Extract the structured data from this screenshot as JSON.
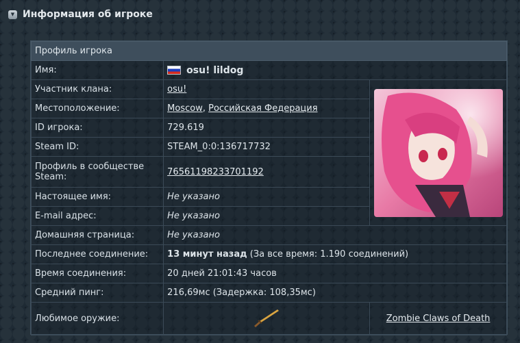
{
  "header": {
    "title": "Информация об игроке"
  },
  "profile": {
    "heading": "Профиль игрока",
    "name_label": "Имя:",
    "name_value": "osu! lildog",
    "clan_label": "Участник клана:",
    "clan_value": "osu!",
    "location_label": "Местоположение:",
    "location_city": "Moscow",
    "location_sep": ", ",
    "location_country": "Российская Федерация",
    "player_id_label": "ID игрока:",
    "player_id_value": "729.619",
    "steam_id_label": "Steam ID:",
    "steam_id_value": "STEAM_0:0:136717732",
    "steam_profile_label": "Профиль в сообществе Steam:",
    "steam_profile_value": "76561198233701192",
    "real_name_label": "Настоящее имя:",
    "real_name_value": "Не указано",
    "email_label": "E-mail адрес:",
    "email_value": "Не указано",
    "homepage_label": "Домашняя страница:",
    "homepage_value": "Не указано",
    "last_conn_label": "Последнее соединение:",
    "last_conn_value": "13 минут назад",
    "last_conn_extra": " (За все время: 1.190 соединений)",
    "conn_time_label": "Время соединения:",
    "conn_time_value": "20 дней 21:01:43 часов",
    "ping_label": "Средний пинг:",
    "ping_value": "216,69мс (Задержка: 108,35мс)",
    "weapon_label": "Любимое оружие:",
    "weapon_value": "Zombie Claws of Death"
  },
  "icons": {
    "flag": "russia-flag-icon",
    "weapon": "knife-icon",
    "collapse": "collapse-icon"
  },
  "colors": {
    "accent_bg": "#3e4e5c",
    "page_bg": "#1e2a34",
    "flag": [
      "#ffffff",
      "#1c3fbf",
      "#d52b1e"
    ]
  }
}
